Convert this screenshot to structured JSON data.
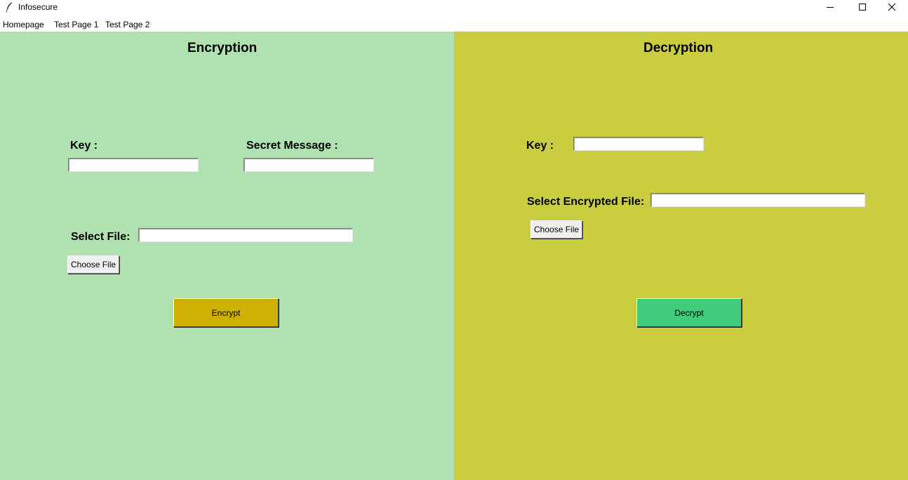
{
  "window": {
    "title": "Infosecure",
    "icon": "feather-icon",
    "controls": [
      "minimize-icon",
      "maximize-icon",
      "close-icon"
    ]
  },
  "menu": {
    "items": [
      "Homepage",
      "Test Page 1",
      "Test Page 2"
    ]
  },
  "encryption": {
    "heading": "Encryption",
    "key_label": "Key :",
    "key_value": "",
    "message_label": "Secret Message :",
    "message_value": "",
    "file_label": "Select File:",
    "file_value": "",
    "choose_file_label": "Choose File",
    "encrypt_label": "Encrypt",
    "bg_color": "#b0e1b0",
    "button_color": "#cdb000"
  },
  "decryption": {
    "heading": "Decryption",
    "key_label": "Key :",
    "key_value": "",
    "file_label": "Select Encrypted File:",
    "file_value": "",
    "choose_file_label": "Choose File",
    "decrypt_label": "Decrypt",
    "bg_color": "#cbcd40",
    "button_color": "#40cd7b"
  }
}
